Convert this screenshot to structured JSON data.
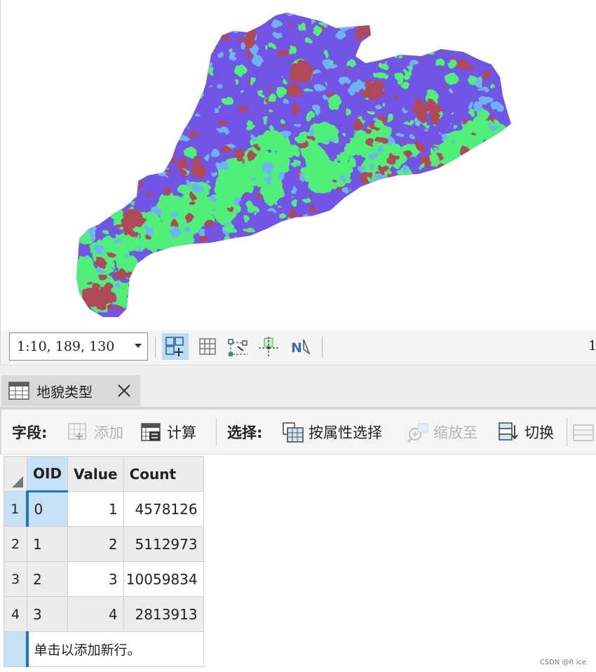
{
  "map": {
    "class_colors": [
      "#7255e6",
      "#50f078",
      "#b04858",
      "#6cb4f4"
    ]
  },
  "map_toolbar": {
    "scale": "1:10, 189, 130",
    "right_cutoff_text": "1"
  },
  "tab": {
    "label": "地貌类型",
    "icon": "table-icon",
    "close_icon": "close-icon"
  },
  "attr_toolbar": {
    "field_label": "字段:",
    "add_label": "添加",
    "calculate_label": "计算",
    "select_label": "选择:",
    "select_by_attr_label": "按属性选择",
    "zoom_to_label": "缩放至",
    "switch_label": "切换"
  },
  "table": {
    "columns": [
      "OID",
      "Value",
      "Count"
    ],
    "rows": [
      {
        "num": "1",
        "oid": "0",
        "value": "1",
        "count": "4578126"
      },
      {
        "num": "2",
        "oid": "1",
        "value": "2",
        "count": "5112973"
      },
      {
        "num": "3",
        "oid": "2",
        "value": "3",
        "count": "10059834"
      },
      {
        "num": "4",
        "oid": "3",
        "value": "4",
        "count": "2813913"
      }
    ],
    "add_row_hint": "单击以添加新行。"
  },
  "watermark": "CSDN @R ice"
}
